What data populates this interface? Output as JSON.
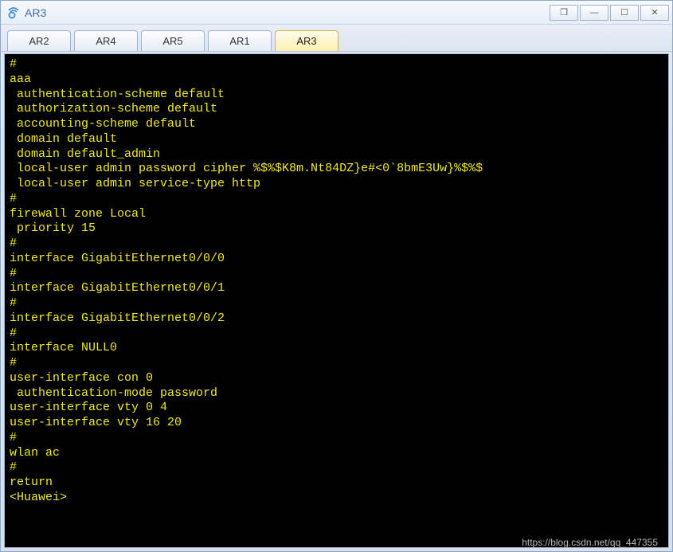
{
  "window": {
    "title": "AR3"
  },
  "winbtns": {
    "dup": "❐",
    "min": "—",
    "max": "☐",
    "close": "✕"
  },
  "tabs": [
    {
      "label": "AR2",
      "active": false
    },
    {
      "label": "AR4",
      "active": false
    },
    {
      "label": "AR5",
      "active": false
    },
    {
      "label": "AR1",
      "active": false
    },
    {
      "label": "AR3",
      "active": true
    }
  ],
  "terminal": {
    "lines": [
      "#",
      "aaa",
      " authentication-scheme default",
      " authorization-scheme default",
      " accounting-scheme default",
      " domain default",
      " domain default_admin",
      " local-user admin password cipher %$%$K8m.Nt84DZ}e#<0`8bmE3Uw}%$%$",
      " local-user admin service-type http",
      "#",
      "firewall zone Local",
      " priority 15",
      "#",
      "interface GigabitEthernet0/0/0",
      "#",
      "interface GigabitEthernet0/0/1",
      "#",
      "interface GigabitEthernet0/0/2",
      "#",
      "interface NULL0",
      "#",
      "user-interface con 0",
      " authentication-mode password",
      "user-interface vty 0 4",
      "user-interface vty 16 20",
      "#",
      "wlan ac",
      "#",
      "return",
      "<Huawei>"
    ]
  },
  "watermark": "https://blog.csdn.net/qq_447355"
}
